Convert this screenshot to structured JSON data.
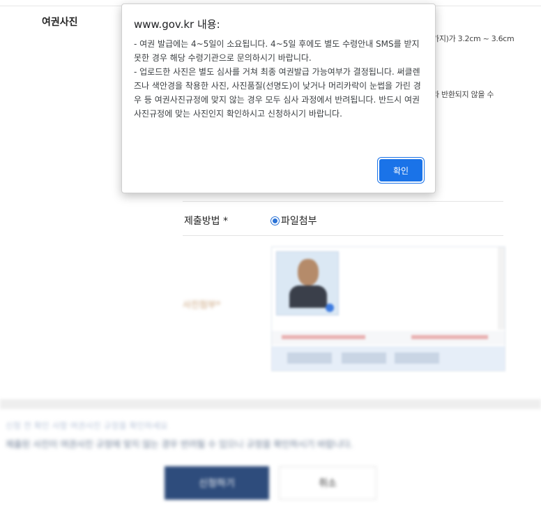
{
  "form": {
    "section_title": "여권사진",
    "side_note_1": "가지)가 3.2cm ~ 3.6cm",
    "side_note_2": "라 반환되지 않을 수",
    "method_label": "제출방법 *",
    "method_option": "파일첨부",
    "photo_label": "사진첨부*"
  },
  "footer": {
    "notice_1": "신청 전 확인 사항 여권사진 규정을 확인하세요",
    "notice_2": "제출된 사진이 여권사진 규정에 맞지 않는 경우 반려될 수 있으니 규정을 확인하시기 바랍니다.",
    "submit_label": "신청하기",
    "cancel_label": "취소"
  },
  "dialog": {
    "title": "www.gov.kr 내용:",
    "messages": [
      "- 여권 발급에는 4~5일이 소요됩니다. 4~5일 후에도 별도 수령안내 SMS를 받지 못한 경우 해당 수령기관으로 문의하시기 바랍니다.",
      "- 업로드한 사진은 별도 심사를 거쳐 최종 여권발급 가능여부가 결정됩니다. 써클렌즈나 색안경을 착용한 사진, 사진품질(선명도)이 낮거나 머리카락이 눈썹을 가린 경우 등 여권사진규정에 맞지 않는 경우 모두 심사 과정에서 반려됩니다. 반드시 여권사진규정에 맞는 사진인지 확인하시고 신청하시기 바랍니다."
    ],
    "ok_label": "확인"
  },
  "colors": {
    "accent": "#1a73e8",
    "primary_button": "#2e4c7c"
  }
}
